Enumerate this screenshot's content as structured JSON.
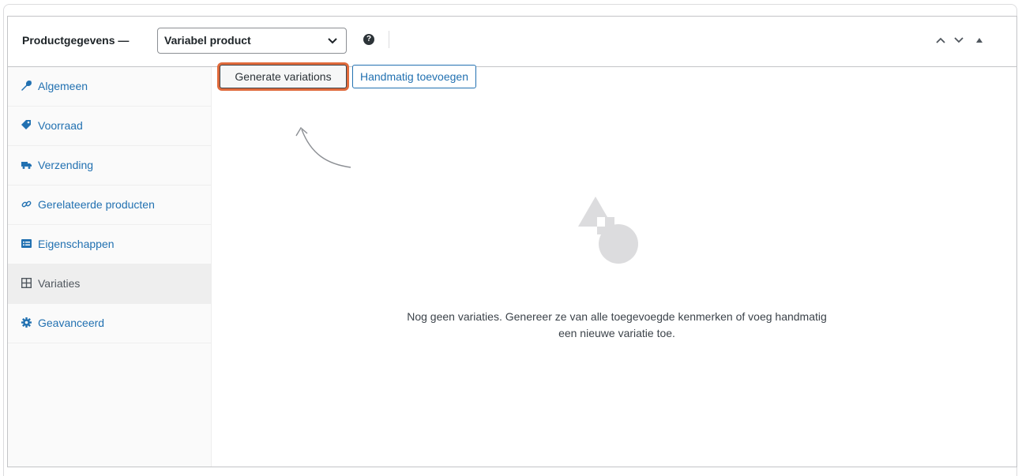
{
  "header": {
    "title": "Productgegevens —",
    "product_type": "Variabel product",
    "help_icon": "question-circle-icon",
    "controls": [
      "move-up-icon",
      "move-down-icon",
      "toggle-panel-icon"
    ]
  },
  "sidebar": {
    "items": [
      {
        "label": "Algemeen",
        "icon": "wrench-icon"
      },
      {
        "label": "Voorraad",
        "icon": "tag-icon"
      },
      {
        "label": "Verzending",
        "icon": "truck-icon"
      },
      {
        "label": "Gerelateerde producten",
        "icon": "link-icon"
      },
      {
        "label": "Eigenschappen",
        "icon": "list-view-icon"
      },
      {
        "label": "Variaties",
        "icon": "grid-icon",
        "active": true
      },
      {
        "label": "Geavanceerd",
        "icon": "gear-icon"
      }
    ]
  },
  "main": {
    "generate_button": "Generate variations",
    "manual_button": "Handmatig toevoegen",
    "empty_text_line1": "Nog geen variaties. Genereer ze van alle toegevoegde kenmerken of voeg handmatig",
    "empty_text_line2": "een nieuwe variatie toe.",
    "empty_icon": "shapes-placeholder-icon"
  },
  "colors": {
    "link": "#2271b1",
    "highlight": "#e06a3b",
    "active_tab_bg": "#eeeeee"
  }
}
